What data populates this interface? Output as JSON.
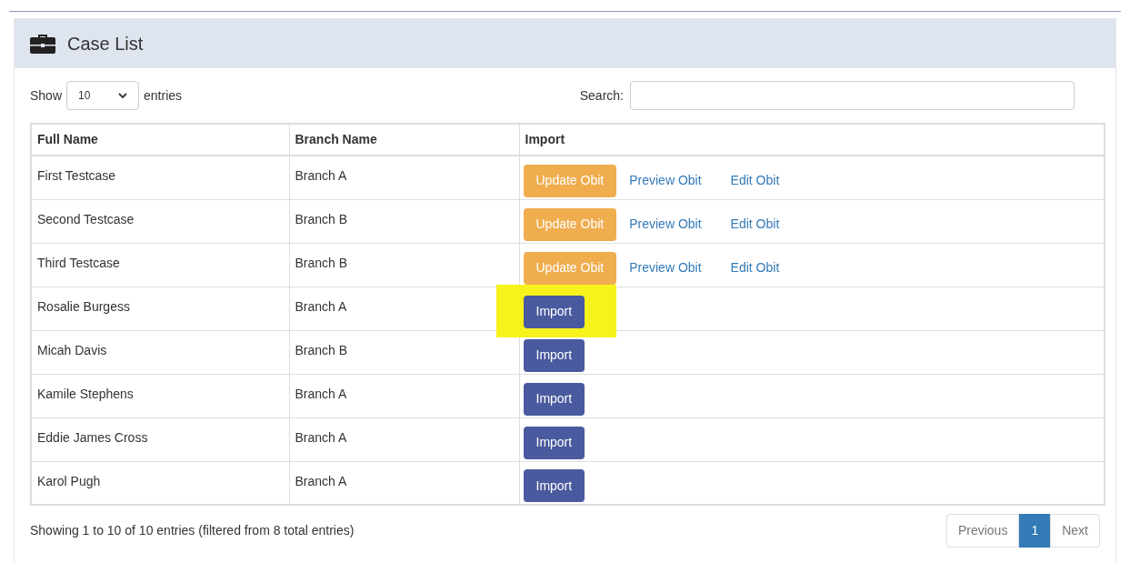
{
  "panel": {
    "title": "Case List"
  },
  "length": {
    "label_before": "Show",
    "value": "10",
    "label_after": "entries"
  },
  "search": {
    "label": "Search:"
  },
  "table": {
    "columns": [
      "Full Name",
      "Branch Name",
      "Import"
    ],
    "rows": [
      {
        "name": "First Testcase",
        "branch": "Branch A",
        "kind": "obit",
        "actions": [
          "Update Obit",
          "Preview Obit",
          "Edit Obit"
        ],
        "highlighted": false
      },
      {
        "name": "Second Testcase",
        "branch": "Branch B",
        "kind": "obit",
        "actions": [
          "Update Obit",
          "Preview Obit",
          "Edit Obit"
        ],
        "highlighted": false
      },
      {
        "name": "Third Testcase",
        "branch": "Branch B",
        "kind": "obit",
        "actions": [
          "Update Obit",
          "Preview Obit",
          "Edit Obit"
        ],
        "highlighted": false
      },
      {
        "name": "Rosalie Burgess",
        "branch": "Branch A",
        "kind": "import",
        "actions": [
          "Import"
        ],
        "highlighted": true
      },
      {
        "name": "Micah Davis",
        "branch": "Branch B",
        "kind": "import",
        "actions": [
          "Import"
        ],
        "highlighted": false
      },
      {
        "name": "Kamile Stephens",
        "branch": "Branch A",
        "kind": "import",
        "actions": [
          "Import"
        ],
        "highlighted": false
      },
      {
        "name": "Eddie James Cross",
        "branch": "Branch A",
        "kind": "import",
        "actions": [
          "Import"
        ],
        "highlighted": false
      },
      {
        "name": "Karol Pugh",
        "branch": "Branch A",
        "kind": "import",
        "actions": [
          "Import"
        ],
        "highlighted": false
      }
    ]
  },
  "info": "Showing 1 to 10 of 10 entries (filtered from 8 total entries)",
  "pagination": [
    {
      "label": "Previous",
      "selected": false
    },
    {
      "label": "1",
      "selected": true
    },
    {
      "label": "Next",
      "selected": false
    }
  ]
}
